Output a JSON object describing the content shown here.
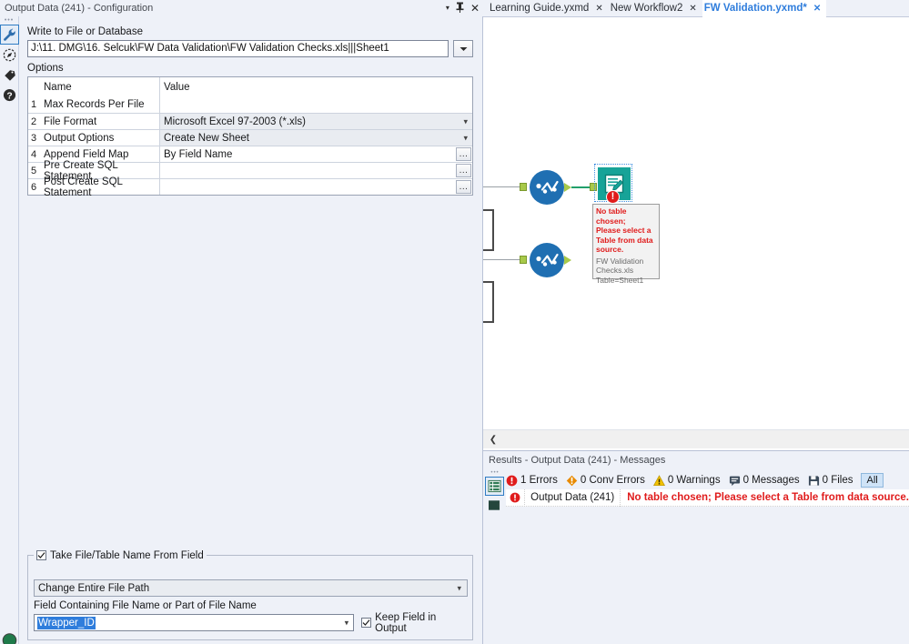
{
  "config_panel": {
    "title": "Output Data (241) - Configuration",
    "titlebar_controls": [
      {
        "name": "dropdown-caret",
        "glyph": "▾"
      },
      {
        "name": "pin",
        "glyph": "╤"
      },
      {
        "name": "close",
        "glyph": "✕"
      }
    ],
    "rail_icons": [
      {
        "name": "wrench-icon",
        "label": "Configuration",
        "selected": true
      },
      {
        "name": "compass-icon",
        "label": "Annotation",
        "selected": false
      },
      {
        "name": "tag-icon",
        "label": "Tag",
        "selected": false
      },
      {
        "name": "help-icon",
        "label": "Help",
        "selected": false
      }
    ],
    "write_label": "Write to File or Database",
    "path_value": "J:\\11. DMG\\16. Selcuk\\FW Data Validation\\FW Validation Checks.xls|||Sheet1",
    "options_label": "Options",
    "options_table": {
      "headers": {
        "num": "",
        "name": "Name",
        "value": "Value"
      },
      "rows": [
        {
          "num": "1",
          "name": "Max Records Per File",
          "value": "",
          "kind": "text",
          "ellipsis": false
        },
        {
          "num": "2",
          "name": "File Format",
          "value": "Microsoft Excel 97-2003 (*.xls)",
          "kind": "dropdown",
          "ellipsis": false
        },
        {
          "num": "3",
          "name": "Output Options",
          "value": "Create New Sheet",
          "kind": "dropdown",
          "ellipsis": false
        },
        {
          "num": "4",
          "name": "Append Field Map",
          "value": "By Field Name",
          "kind": "text",
          "ellipsis": true
        },
        {
          "num": "5",
          "name": "Pre Create SQL Statement",
          "value": "",
          "kind": "text",
          "ellipsis": true
        },
        {
          "num": "6",
          "name": "Post Create SQL Statement",
          "value": "",
          "kind": "text",
          "ellipsis": true
        }
      ],
      "ellipsis_label": "..."
    },
    "take_name_group": {
      "checkbox_label": "Take File/Table Name From Field",
      "checkbox_checked": true,
      "mode_select_value": "Change Entire File Path",
      "field_label": "Field Containing File Name or Part of File Name",
      "field_value": "Wrapper_ID",
      "keep_field_label": "Keep Field in Output",
      "keep_field_checked": true
    }
  },
  "workspace": {
    "tabs": [
      {
        "label": "Learning Guide.yxmd",
        "active": false,
        "close_glyph": "✕"
      },
      {
        "label": "New Workflow2",
        "active": false,
        "close_glyph": "✕"
      },
      {
        "label": "FW Validation.yxmd*",
        "active": true,
        "close_glyph": "✕"
      }
    ],
    "canvas": {
      "tool_node": {
        "name": "output-data-tool",
        "error_badge": "!",
        "selected": true
      },
      "annotation": {
        "error_lines": [
          "No table chosen;",
          "Please select a",
          "Table from data",
          "source."
        ],
        "detail_lines": [
          "FW Validation",
          "Checks.xls",
          "Table=Sheet1"
        ]
      },
      "scroll_left_glyph": "❮"
    }
  },
  "results": {
    "title": "Results - Output Data (241) - Messages",
    "rail_icons": [
      {
        "name": "message-list-icon",
        "selected": true
      },
      {
        "name": "data-output-icon",
        "selected": false
      }
    ],
    "filters": [
      {
        "name": "errors-filter",
        "icon": "error-icon",
        "label": "1 Errors",
        "color": "#e01b1b"
      },
      {
        "name": "conv-errors-filter",
        "icon": "conv-error-icon",
        "label": "0 Conv Errors",
        "color": "#e88a00"
      },
      {
        "name": "warnings-filter",
        "icon": "warning-icon",
        "label": "0 Warnings",
        "color": "#f2c200"
      },
      {
        "name": "messages-filter",
        "icon": "message-icon",
        "label": "0 Messages",
        "color": "#3b4a5a"
      },
      {
        "name": "files-filter",
        "icon": "save-icon",
        "label": "0 Files",
        "color": "#3b4a5a"
      }
    ],
    "all_button": "All",
    "message_row": {
      "icon": "error-icon",
      "tool": "Output Data (241)",
      "text": "No table chosen; Please select a Table from data source."
    }
  },
  "colors": {
    "accent_blue": "#2f7ddc",
    "error_red": "#e01b1b",
    "tool_teal": "#17a398",
    "node_blue": "#1f6fb2",
    "port_green": "#a8c94a",
    "wire_green": "#22a06b",
    "panel_bg": "#eef1f8"
  }
}
